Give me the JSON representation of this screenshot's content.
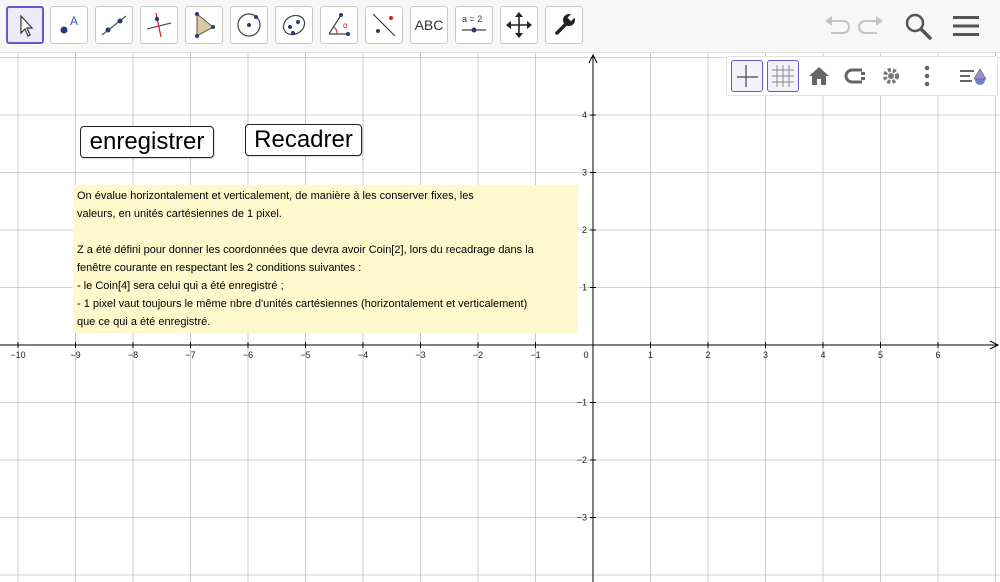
{
  "toolbar": {
    "tools": [
      {
        "name": "move-tool-icon",
        "active": true
      },
      {
        "name": "point-tool-icon",
        "label": "A"
      },
      {
        "name": "line-tool-icon"
      },
      {
        "name": "perpendicular-tool-icon"
      },
      {
        "name": "polygon-tool-icon"
      },
      {
        "name": "circle-center-tool-icon"
      },
      {
        "name": "ellipse-tool-icon"
      },
      {
        "name": "angle-tool-icon",
        "label": "α"
      },
      {
        "name": "reflect-tool-icon"
      },
      {
        "name": "text-tool-icon",
        "label": "ABC"
      },
      {
        "name": "slider-tool-icon",
        "label": "a = 2"
      },
      {
        "name": "move-graphics-tool-icon"
      },
      {
        "name": "wrench-tool-icon"
      }
    ],
    "right": [
      "undo-icon",
      "redo-icon",
      "search-icon",
      "menu-icon"
    ]
  },
  "stylebar": [
    "axes-icon",
    "grid-icon",
    "home-icon",
    "label-style-icon",
    "settings-icon",
    "more-icon",
    "toggle-stylebar-icon"
  ],
  "buttons": {
    "save_label": "enregistrer",
    "reframe_label": "Recadrer"
  },
  "textbox": {
    "line1": "On évalue horizontalement et verticalement, de manière à les conserver fixes, les",
    "line2": "valeurs, en unités cartésiennes de 1 pixel.",
    "line3": "Z a été défini pour donner les coordonnées que devra avoir Coin[2], lors du recadrage dans la",
    "line4": "fenêtre courante en respectant les 2 conditions suivantes :",
    "line5": "- le Coin[4] sera celui qui a été enregistré ;",
    "line6": "- 1 pixel vaut toujours le même nbre d'unités cartésiennes (horizontalement et verticalement)",
    "line7": "que ce qui a été enregistré."
  },
  "axes": {
    "x_ticks": [
      -10,
      -9,
      -8,
      -7,
      -6,
      -5,
      -4,
      -3,
      -2,
      -1,
      0,
      1,
      2,
      3,
      4,
      5,
      6
    ],
    "y_ticks": [
      4,
      3,
      2,
      1,
      -1,
      -2,
      -3
    ],
    "xlim": [
      -10.2,
      7.1
    ],
    "ylim": [
      -4.0,
      5.0
    ],
    "grid": true
  },
  "colors": {
    "accent": "#6557d2",
    "textbox_bg": "#fff8cc",
    "grid": "#c0c0c0"
  }
}
